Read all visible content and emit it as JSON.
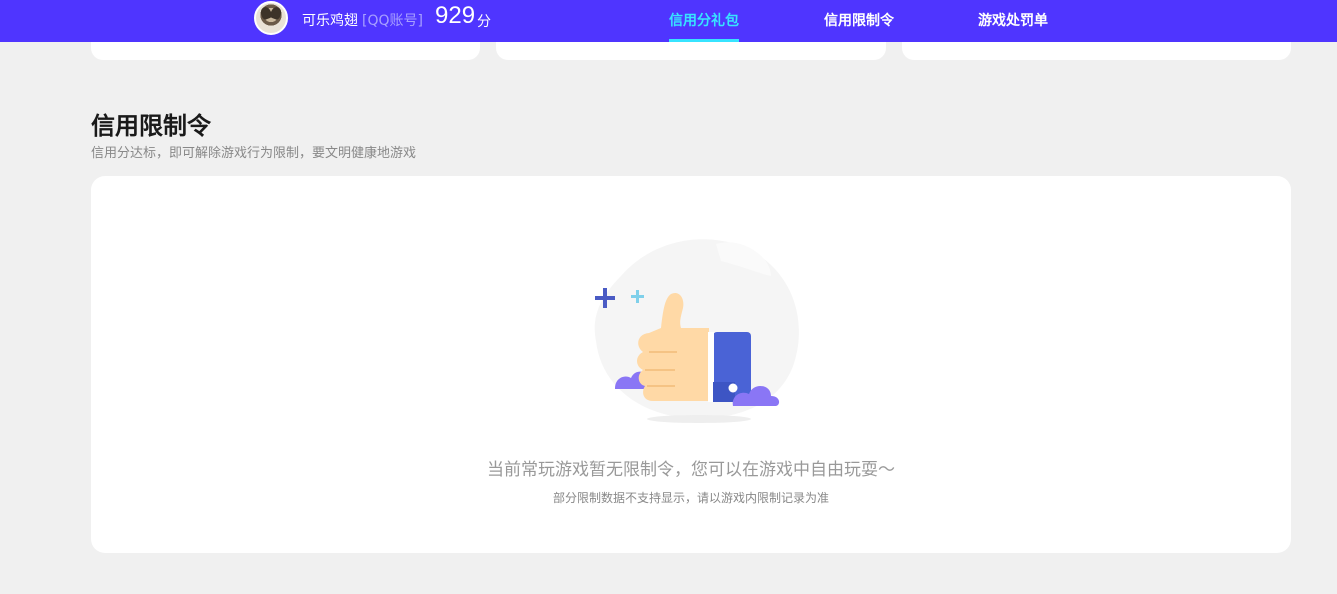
{
  "header": {
    "user_name": "可乐鸡翅",
    "account_tag": "[QQ账号]",
    "score": "929",
    "score_unit": "分",
    "tabs": [
      {
        "label": "信用分礼包",
        "active": true
      },
      {
        "label": "信用限制令",
        "active": false
      },
      {
        "label": "游戏处罚单",
        "active": false
      }
    ],
    "active_color": "#37e4ff",
    "bar_color": "#4f35ff"
  },
  "section": {
    "title": "信用限制令",
    "subtitle": "信用分达标，即可解除游戏行为限制，要文明健康地游戏"
  },
  "empty_state": {
    "icon": "thumbs-up-illustration",
    "message": "当前常玩游戏暂无限制令，您可以在游戏中自由玩耍～",
    "note": "部分限制数据不支持显示，请以游戏内限制记录为准"
  }
}
